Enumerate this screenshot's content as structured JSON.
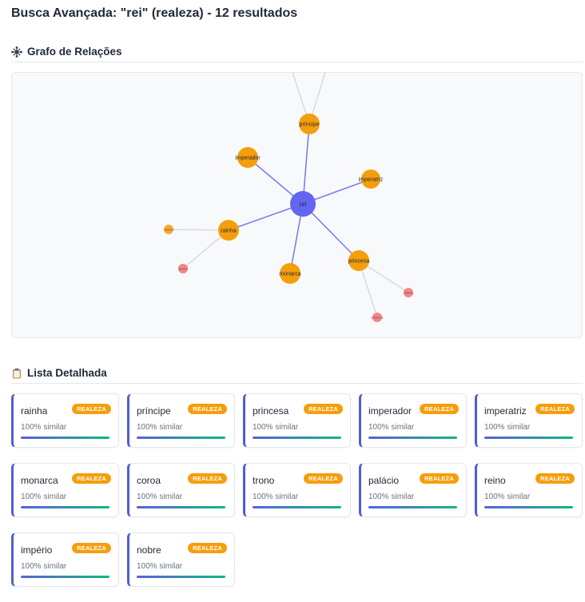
{
  "page": {
    "title": "Busca Avançada: \"rei\" (realeza) - 12 resultados",
    "graph_section": "Grafo de Relações",
    "list_section": "Lista Detalhada"
  },
  "colors": {
    "center_node": "#6366f1",
    "related_node": "#f59e0b",
    "secondary_node": "#f87171",
    "primary_edge": "#7c7fe6",
    "secondary_edge": "#cfd3d8",
    "badge": "#f59e0b",
    "card_accent_left": "#4f5fd6",
    "bar_start": "#5b5fe0",
    "bar_end": "#10b981"
  },
  "graph": {
    "center": "rei",
    "related": [
      "príncipe",
      "imperador",
      "imperatriz",
      "rainha",
      "monarca",
      "princesa"
    ],
    "secondary": [
      "rainha",
      "rainha",
      "rainha",
      "princesa",
      "princesa"
    ]
  },
  "results": [
    {
      "name": "rainha",
      "badge": "REALEZA",
      "similarity_text": "100% similar",
      "similarity": 1.0
    },
    {
      "name": "príncipe",
      "badge": "REALEZA",
      "similarity_text": "100% similar",
      "similarity": 1.0
    },
    {
      "name": "princesa",
      "badge": "REALEZA",
      "similarity_text": "100% similar",
      "similarity": 1.0
    },
    {
      "name": "imperador",
      "badge": "REALEZA",
      "similarity_text": "100% similar",
      "similarity": 1.0
    },
    {
      "name": "imperatriz",
      "badge": "REALEZA",
      "similarity_text": "100% similar",
      "similarity": 1.0
    },
    {
      "name": "monarca",
      "badge": "REALEZA",
      "similarity_text": "100% similar",
      "similarity": 1.0
    },
    {
      "name": "coroa",
      "badge": "REALEZA",
      "similarity_text": "100% similar",
      "similarity": 1.0
    },
    {
      "name": "trono",
      "badge": "REALEZA",
      "similarity_text": "100% similar",
      "similarity": 1.0
    },
    {
      "name": "palácio",
      "badge": "REALEZA",
      "similarity_text": "100% similar",
      "similarity": 1.0
    },
    {
      "name": "reino",
      "badge": "REALEZA",
      "similarity_text": "100% similar",
      "similarity": 1.0
    },
    {
      "name": "império",
      "badge": "REALEZA",
      "similarity_text": "100% similar",
      "similarity": 1.0
    },
    {
      "name": "nobre",
      "badge": "REALEZA",
      "similarity_text": "100% similar",
      "similarity": 1.0
    }
  ]
}
